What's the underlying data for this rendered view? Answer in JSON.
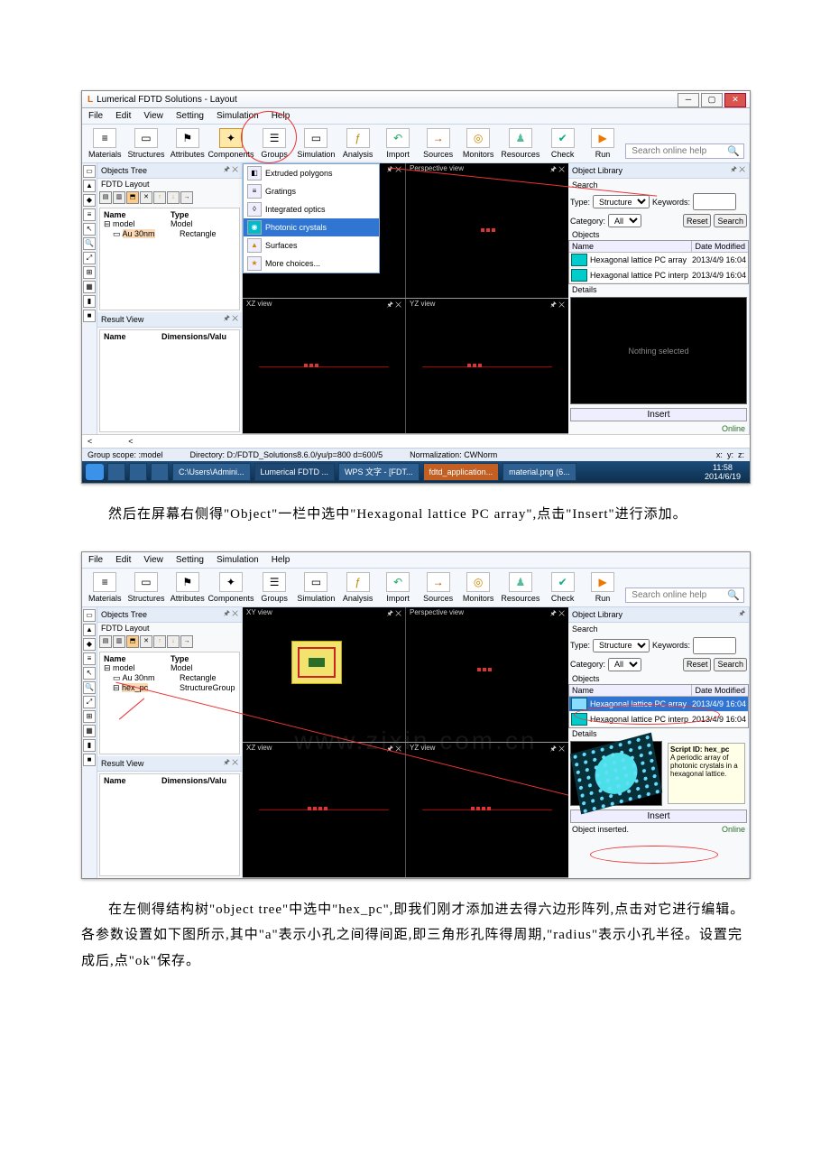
{
  "window_title": "Lumerical FDTD Solutions - Layout",
  "menus": [
    "File",
    "Edit",
    "View",
    "Setting",
    "Simulation",
    "Help"
  ],
  "toolbar": [
    {
      "label": "Materials",
      "glyph": "≡"
    },
    {
      "label": "Structures",
      "glyph": "▭"
    },
    {
      "label": "Attributes",
      "glyph": "⚑"
    },
    {
      "label": "Components",
      "glyph": "✦"
    },
    {
      "label": "Groups",
      "glyph": "☰"
    },
    {
      "label": "Simulation",
      "glyph": "▭"
    },
    {
      "label": "Analysis",
      "glyph": "ƒ"
    },
    {
      "label": "Import",
      "glyph": "↶"
    },
    {
      "label": "Sources",
      "glyph": "→"
    },
    {
      "label": "Monitors",
      "glyph": "◎"
    },
    {
      "label": "Resources",
      "glyph": "♟"
    },
    {
      "label": "Check",
      "glyph": "✔"
    },
    {
      "label": "Run",
      "glyph": "▶"
    }
  ],
  "search_help": "Search online help",
  "panels": {
    "objects_tree": "Objects Tree",
    "fdtd_layout": "FDTD Layout",
    "result_view": "Result View",
    "object_library": "Object Library"
  },
  "tree_headers": {
    "name": "Name",
    "type": "Type"
  },
  "tree_rows": [
    {
      "name": "model",
      "type": "Model"
    },
    {
      "name": "Au 30nm",
      "type": "Rectangle"
    }
  ],
  "tree_rows2": [
    {
      "name": "model",
      "type": "Model"
    },
    {
      "name": "Au 30nm",
      "type": "Rectangle"
    },
    {
      "name": "hex_pc",
      "type": "StructureGroup"
    }
  ],
  "result_headers": {
    "name": "Name",
    "dims": "Dimensions/Valu"
  },
  "views": {
    "xy": "XY view",
    "persp": "Perspective view",
    "xz": "XZ view",
    "yz": "YZ view"
  },
  "dropdown": [
    "Extruded polygons",
    "Gratings",
    "Integrated optics",
    "Photonic crystals",
    "Surfaces",
    "More choices..."
  ],
  "library": {
    "search_label": "Search",
    "type_label": "Type:",
    "type_value": "Structure",
    "keywords_label": "Keywords:",
    "category_label": "Category:",
    "category_value": "All",
    "reset": "Reset",
    "search_btn": "Search",
    "objects_label": "Objects",
    "headers": {
      "name": "Name",
      "date": "Date Modified"
    },
    "rows": [
      {
        "name": "Hexagonal lattice PC array",
        "date": "2013/4/9 16:04"
      },
      {
        "name": "Hexagonal lattice PC interp",
        "date": "2013/4/9 16:04"
      }
    ],
    "details_label": "Details",
    "nothing": "Nothing selected",
    "insert": "Insert",
    "online": "Online",
    "inserted": "Object inserted.",
    "script_id": "Script ID: hex_pc",
    "desc": "A periodic array of photonic crystals in a hexagonal lattice."
  },
  "statusbar": {
    "group": "Group scope: :model",
    "dir": "Directory: D:/FDTD_Solutions8.6.0/yu/p=800  d=600/5",
    "norm": "Normalization: CWNorm",
    "x": "x:",
    "y": "y:",
    "z": "z:"
  },
  "taskbar": {
    "items": [
      "C:\\Users\\Admini...",
      "Lumerical FDTD ...",
      "WPS 文字 - [FDT...",
      "fdtd_application...",
      "material.png (6..."
    ],
    "time": "11:58",
    "date": "2014/6/19"
  },
  "paragraph1": "然后在屏幕右侧得\"Object\"一栏中选中\"Hexagonal lattice PC array\",点击\"Insert\"进行添加。",
  "paragraph2": "在左侧得结构树\"object tree\"中选中\"hex_pc\",即我们刚才添加进去得六边形阵列,点击对它进行编辑。各参数设置如下图所示,其中\"a\"表示小孔之间得间距,即三角形孔阵得周期,\"radius\"表示小孔半径。设置完成后,点\"ok\"保存。"
}
